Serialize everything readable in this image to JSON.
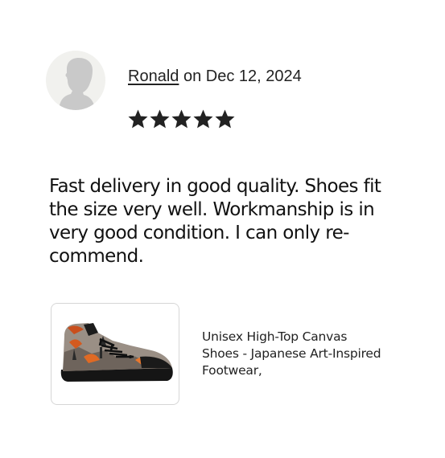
{
  "review": {
    "author": "Ronald",
    "date_prefix": " on ",
    "date": "Dec 12, 2024",
    "rating": 5,
    "rating_max": 5,
    "text": "Fast delivery in good quality. Shoes fit\nthe size very well. Workmanship is in\nvery good condition. I can only re-\ncommend."
  },
  "product": {
    "title": "Unisex High-Top Canvas\nShoes - Japanese Art-Inspired\nFootwear,"
  },
  "icons": {
    "avatar": "default-user-silhouette-icon",
    "star": "filled-star-icon"
  },
  "colors": {
    "star": "#222222",
    "avatar_bg": "#f1f1ee",
    "avatar_silhouette": "#c9c9c9",
    "thumb_border": "#d6d6d6"
  }
}
